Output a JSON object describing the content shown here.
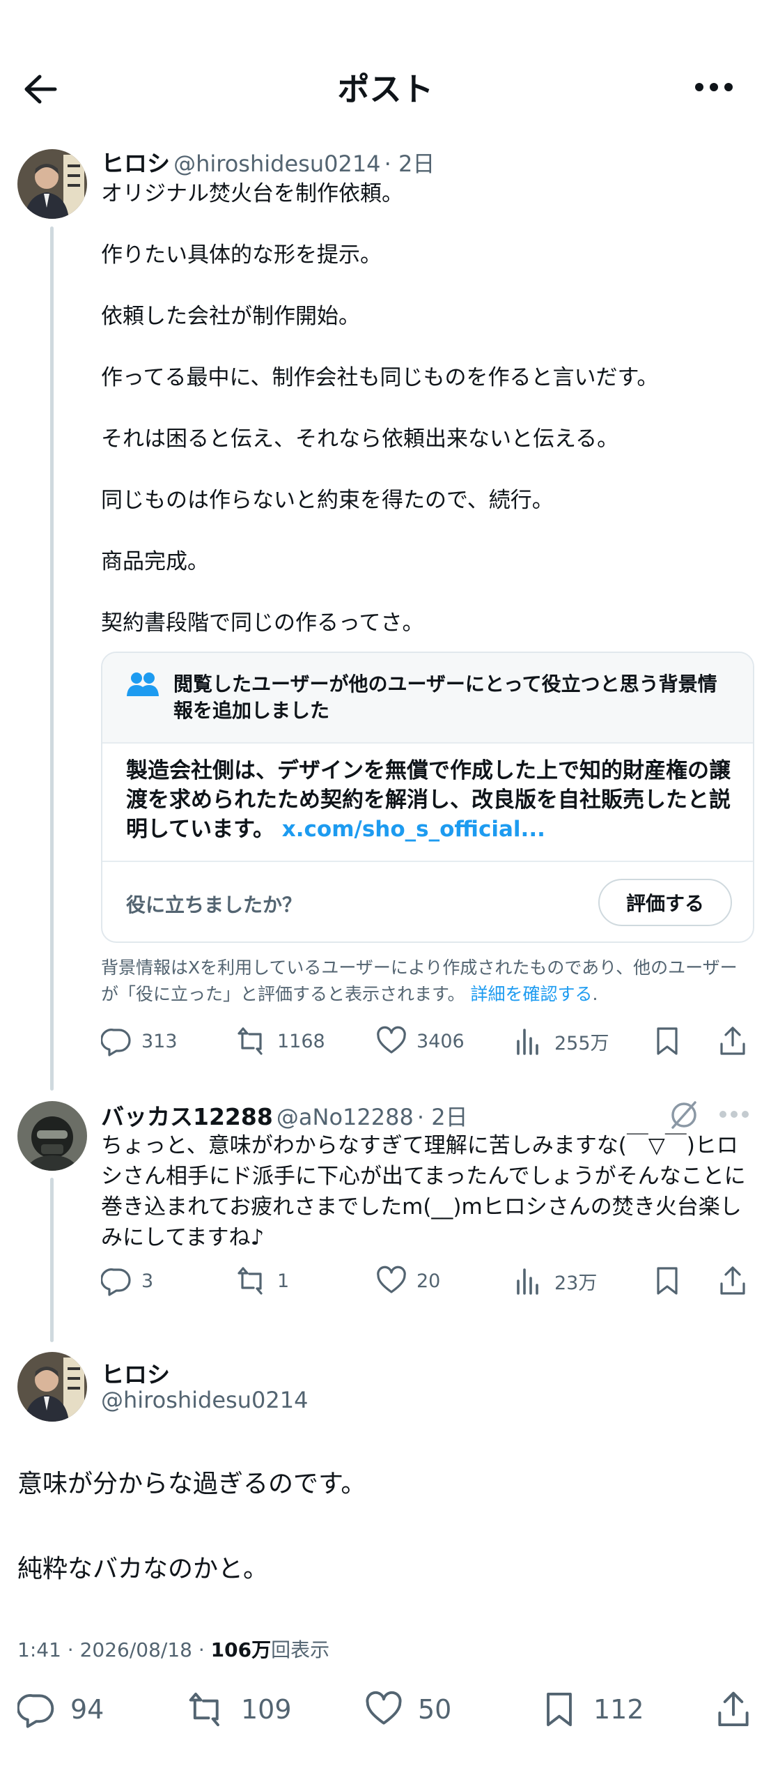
{
  "header": {
    "title": "ポスト"
  },
  "post1": {
    "name": "ヒロシ",
    "handle": "@hiroshidesu0214",
    "time": "2日",
    "lines": [
      "オリジナル焚火台を制作依頼。",
      "作りたい具体的な形を提示。",
      "依頼した会社が制作開始。",
      "作ってる最中に、制作会社も同じものを作ると言いだす。",
      "それは困ると伝え、それなら依頼出来ないと伝える。",
      "同じものは作らないと約束を得たので、続行。",
      "商品完成。",
      "契約書段階で同じの作るってさ。"
    ],
    "note": {
      "header": "閲覧したユーザーが他のユーザーにとって役立つと思う背景情報を追加しました",
      "body": "製造会社側は、デザインを無償で作成した上で知的財産権の譲渡を求められたため契約を解消し、改良版を自社販売したと説明しています。",
      "link": "x.com/sho_s_official...",
      "question": "役に立ちましたか？",
      "rate_label": "評価する"
    },
    "disclaimer": "背景情報はXを利用しているユーザーにより作成されたものであり、他のユーザーが「役に立った」と評価すると表示されます。",
    "disclaimer_link": "詳細を確認する",
    "stats": {
      "replies": "313",
      "reposts": "1168",
      "likes": "3406",
      "views": "255万"
    }
  },
  "post2": {
    "name": "バッカス12288",
    "handle": "@aNo12288",
    "time": "2日",
    "text": "ちょっと、意味がわからなすぎて理解に苦しみますな(￣▽￣)ヒロシさん相手にド派手に下心が出てまったんでしょうがそんなことに巻き込まれてお疲れさまでしたm(__)mヒロシさんの焚き火台楽しみにしてますね♪",
    "stats": {
      "replies": "3",
      "reposts": "1",
      "likes": "20",
      "views": "23万"
    }
  },
  "main": {
    "name": "ヒロシ",
    "handle": "@hiroshidesu0214",
    "lines": [
      "意味が分からな過ぎるのです。",
      "純粋なバカなのかと。"
    ],
    "timestamp": "1:41 · 2026/08/18 · ",
    "views_count": "106万",
    "views_label": "回表示",
    "stats": {
      "replies": "94",
      "reposts": "109",
      "likes": "50",
      "bookmarks": "112"
    }
  },
  "colors": {
    "link": "#1d9bf0",
    "secondary": "#536471",
    "thread_line": "#cfd9de"
  },
  "icons": [
    "back-arrow-icon",
    "more-icon",
    "people-icon",
    "reply-icon",
    "repost-icon",
    "like-icon",
    "views-icon",
    "bookmark-icon",
    "share-icon",
    "grok-icon"
  ]
}
